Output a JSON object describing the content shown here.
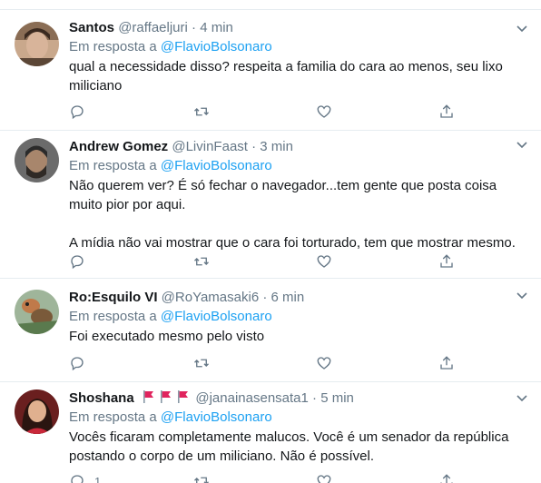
{
  "colors": {
    "text": "#14171a",
    "secondary": "#657786",
    "link": "#1da1f2",
    "border": "#e6ecf0",
    "flag": "#e0245e"
  },
  "tweets": [
    {
      "name": "Santos",
      "handle": "@raffaeljuri",
      "dot": "·",
      "time": "4 min",
      "reply_prefix": "Em resposta a ",
      "reply_to": "@FlavioBolsonaro",
      "paragraphs": [
        "qual a necessidade disso? respeita a familia do cara ao menos, seu lixo miliciano"
      ],
      "reply_count": ""
    },
    {
      "name": "Andrew Gomez",
      "handle": "@LivinFaast",
      "dot": "·",
      "time": "3 min",
      "reply_prefix": "Em resposta a ",
      "reply_to": "@FlavioBolsonaro",
      "paragraphs": [
        "Não querem ver? É só fechar o navegador...tem gente que posta coisa muito pior por aqui.",
        "A mídia não vai mostrar que o cara foi torturado, tem que mostrar mesmo."
      ],
      "reply_count": ""
    },
    {
      "name": "Ro:Esquilo VI",
      "handle": "@RoYamasaki6",
      "dot": "·",
      "time": "6 min",
      "reply_prefix": "Em resposta a ",
      "reply_to": "@FlavioBolsonaro",
      "paragraphs": [
        "Foi executado mesmo pelo visto"
      ],
      "reply_count": ""
    },
    {
      "name": "Shoshana",
      "flags": [
        "red-flag-icon",
        "red-flag-icon",
        "red-flag-icon"
      ],
      "handle": "@janainasensata1",
      "dot": "·",
      "time": "5 min",
      "reply_prefix": "Em resposta a ",
      "reply_to": "@FlavioBolsonaro",
      "paragraphs": [
        "Vocês ficaram completamente malucos. Você é um senador da república postando o corpo de um miliciano. Não é possível."
      ],
      "reply_count": "1"
    }
  ]
}
